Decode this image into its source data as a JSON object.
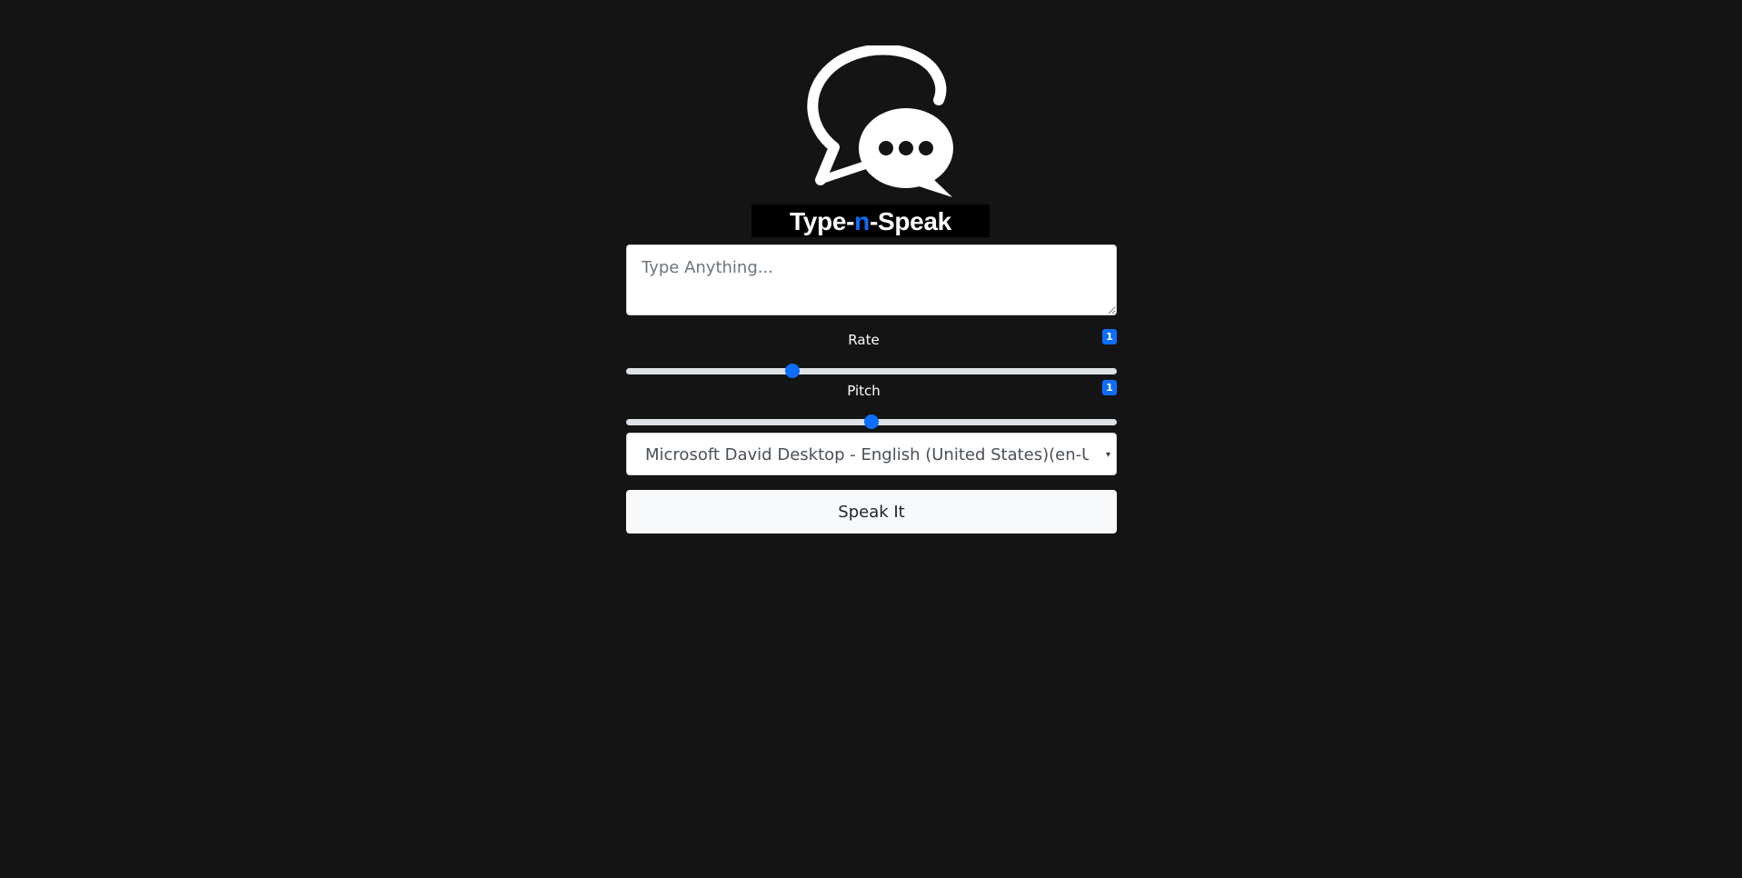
{
  "logo": {
    "icon": "chat-bubbles-icon",
    "text_part1": "Type-",
    "text_accent": "n",
    "text_part2": "-Speak",
    "accent_color": "#0d6efd"
  },
  "text_input": {
    "placeholder": "Type Anything...",
    "value": ""
  },
  "rate": {
    "label": "Rate",
    "badge": "1",
    "value": 1,
    "min": 0.5,
    "max": 2
  },
  "pitch": {
    "label": "Pitch",
    "badge": "1",
    "value": 1,
    "min": 0,
    "max": 2
  },
  "voice_select": {
    "selected": "Microsoft David Desktop - English (United States)(en-US)",
    "icon": "caret-down-icon"
  },
  "speak_button": {
    "label": "Speak It"
  },
  "colors": {
    "background": "#141414",
    "accent": "#0d6efd",
    "button_bg": "#f8f9fa"
  }
}
